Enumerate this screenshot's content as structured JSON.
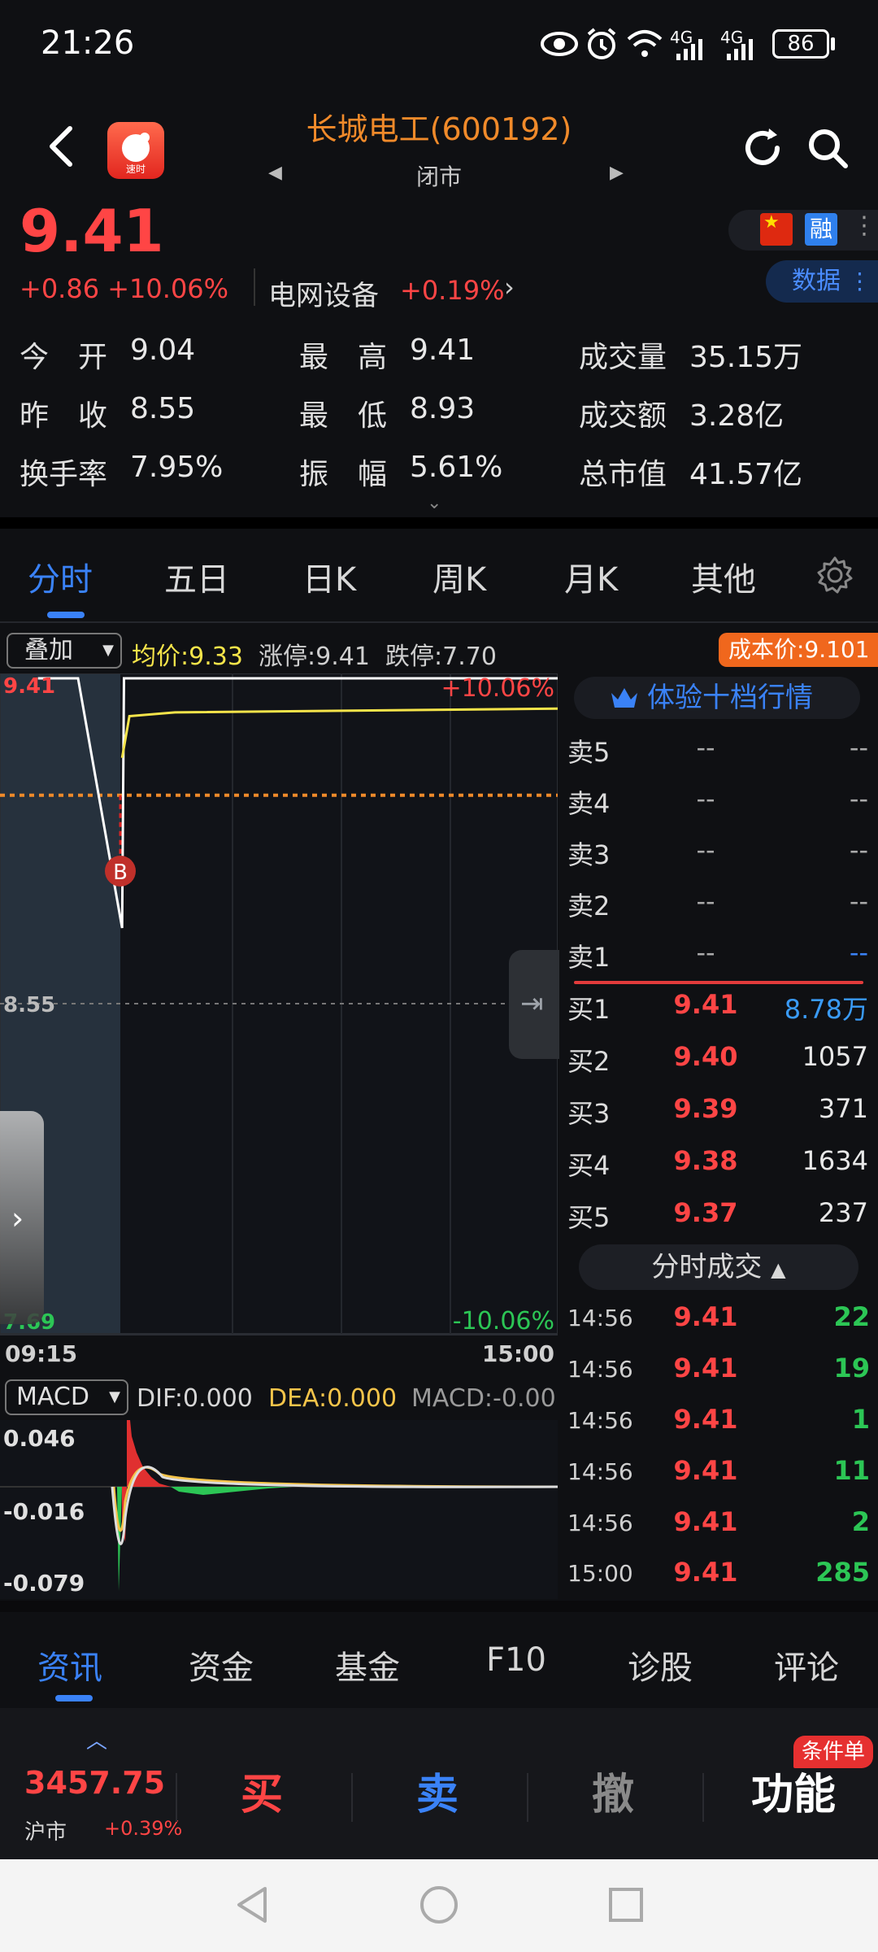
{
  "status_bar": {
    "time": "21:26",
    "network_1": "4G",
    "network_2": "4G",
    "battery": "86"
  },
  "header": {
    "title": "长城电工(600192)",
    "market_status": "闭市",
    "prev_arrow": "◀",
    "next_arrow": "▶",
    "logo_text": "速时"
  },
  "quote": {
    "price": "9.41",
    "change": "+0.86  +10.06%",
    "sector_name": "电网设备",
    "sector_change": "+0.19%",
    "flag_label": "★",
    "rong_badge": "融",
    "data_button": "数据"
  },
  "stats": [
    {
      "label": "今　开",
      "value": "9.04"
    },
    {
      "label": "昨　收",
      "value": "8.55"
    },
    {
      "label": "换手率",
      "value": "7.95%"
    },
    {
      "label": "最　高",
      "value": "9.41"
    },
    {
      "label": "最　低",
      "value": "8.93"
    },
    {
      "label": "振　幅",
      "value": "5.61%"
    },
    {
      "label": "成交量",
      "value": "35.15万"
    },
    {
      "label": "成交额",
      "value": "3.28亿"
    },
    {
      "label": "总市值",
      "value": "41.57亿"
    }
  ],
  "chart_tabs": [
    "分时",
    "五日",
    "日K",
    "周K",
    "月K",
    "其他"
  ],
  "chart_info": {
    "overlay_select": "叠加",
    "avg_price": "均价:9.33",
    "limit_up": "涨停:9.41",
    "limit_down": "跌停:7.70",
    "cost_price": "成本价:9.101"
  },
  "chart_data": {
    "type": "line",
    "y_top_label": "9.41",
    "y_mid_label": "8.55",
    "y_bottom_label": "7.69",
    "pct_top_label": "+10.06%",
    "pct_bottom_label": "-10.06%",
    "x_start_label": "09:15",
    "x_end_label": "15:00",
    "marker_label": "B",
    "ylim": [
      7.69,
      9.41
    ],
    "prev_close": 8.55,
    "cost_price": 9.101,
    "series": [
      {
        "name": "price",
        "color": "#ffffff",
        "x": [
          "09:25",
          "09:30",
          "09:31",
          "09:32",
          "10:00",
          "15:00"
        ],
        "values": [
          9.41,
          9.41,
          8.75,
          9.41,
          9.41,
          9.41
        ]
      },
      {
        "name": "avg",
        "color": "#f5e44a",
        "x": [
          "09:31",
          "09:35",
          "10:00",
          "15:00"
        ],
        "values": [
          9.2,
          9.31,
          9.32,
          9.33
        ]
      }
    ],
    "macd": {
      "select_label": "MACD",
      "dif_label": "DIF:0.000",
      "dea_label": "DEA:0.000",
      "macd_label": "MACD:-0.00",
      "ytick_top": "0.046",
      "ytick_mid": "-0.016",
      "ytick_bottom": "-0.079",
      "ylim": [
        -0.079,
        0.046
      ]
    }
  },
  "order_book": {
    "banner": "体验十档行情",
    "asks": [
      {
        "label": "卖5",
        "price": "--",
        "volume": "--"
      },
      {
        "label": "卖4",
        "price": "--",
        "volume": "--"
      },
      {
        "label": "卖3",
        "price": "--",
        "volume": "--"
      },
      {
        "label": "卖2",
        "price": "--",
        "volume": "--"
      },
      {
        "label": "卖1",
        "price": "--",
        "volume": "--"
      }
    ],
    "bids": [
      {
        "label": "买1",
        "price": "9.41",
        "volume": "8.78万"
      },
      {
        "label": "买2",
        "price": "9.40",
        "volume": "1057"
      },
      {
        "label": "买3",
        "price": "9.39",
        "volume": "371"
      },
      {
        "label": "买4",
        "price": "9.38",
        "volume": "1634"
      },
      {
        "label": "买5",
        "price": "9.37",
        "volume": "237"
      }
    ]
  },
  "trades": {
    "toggle_label": "分时成交",
    "rows": [
      {
        "time": "14:56",
        "price": "9.41",
        "volume": "22"
      },
      {
        "time": "14:56",
        "price": "9.41",
        "volume": "19"
      },
      {
        "time": "14:56",
        "price": "9.41",
        "volume": "1"
      },
      {
        "time": "14:56",
        "price": "9.41",
        "volume": "11"
      },
      {
        "time": "14:56",
        "price": "9.41",
        "volume": "2"
      },
      {
        "time": "15:00",
        "price": "9.41",
        "volume": "285"
      }
    ]
  },
  "bottom_tabs": [
    "资讯",
    "资金",
    "基金",
    "F10",
    "诊股",
    "评论"
  ],
  "trade_bar": {
    "index_value": "3457.75",
    "index_name": "沪市",
    "index_change": "+0.39%",
    "buy": "买",
    "sell": "卖",
    "cancel": "撤",
    "functions": "功能",
    "condition_badge": "条件单"
  },
  "colors": {
    "up": "#ff4545",
    "down": "#2cc655",
    "accent": "#3a82f7",
    "title": "#f08a2a",
    "avg_line": "#f5e44a"
  }
}
